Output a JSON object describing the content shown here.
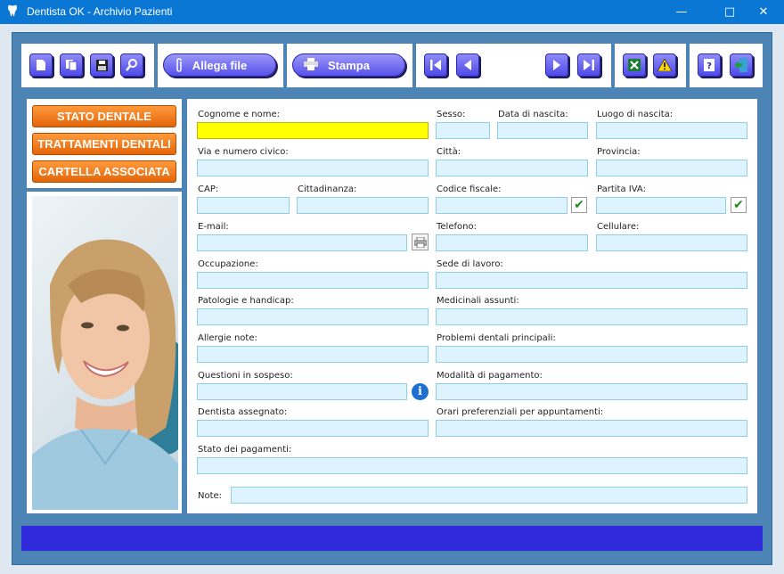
{
  "window": {
    "title": "Dentista OK - Archivio Pazienti",
    "app_icon": "tooth-icon",
    "controls": [
      "minimize-icon",
      "maximize-icon",
      "close-icon"
    ]
  },
  "toolbar": {
    "record_buttons": [
      "new-record-icon",
      "copy-record-icon",
      "save-icon",
      "search-icon"
    ],
    "attach_label": "Allega file",
    "print_label": "Stampa",
    "nav_buttons": [
      "first-record-icon",
      "previous-record-icon",
      "next-record-icon",
      "last-record-icon"
    ],
    "tool_buttons": [
      "excel-export-icon",
      "warning-icon"
    ],
    "help_buttons": [
      "help-icon",
      "exit-icon"
    ]
  },
  "side_nav": {
    "items": [
      "STATO DENTALE",
      "TRATTAMENTI DENTALI",
      "CARTELLA ASSOCIATA"
    ]
  },
  "form": {
    "cognome_nome": {
      "label": "Cognome e nome:",
      "value": ""
    },
    "sesso": {
      "label": "Sesso:",
      "value": ""
    },
    "data_nascita": {
      "label": "Data di nascita:",
      "value": ""
    },
    "luogo_nascita": {
      "label": "Luogo di nascita:",
      "value": ""
    },
    "via": {
      "label": "Via e numero civico:",
      "value": ""
    },
    "citta": {
      "label": "Città:",
      "value": ""
    },
    "provincia": {
      "label": "Provincia:",
      "value": ""
    },
    "cap": {
      "label": "CAP:",
      "value": ""
    },
    "cittadinanza": {
      "label": "Cittadinanza:",
      "value": ""
    },
    "codice_fiscale": {
      "label": "Codice fiscale:",
      "value": ""
    },
    "partita_iva": {
      "label": "Partita IVA:",
      "value": ""
    },
    "email": {
      "label": "E-mail:",
      "value": ""
    },
    "telefono": {
      "label": "Telefono:",
      "value": ""
    },
    "cellulare": {
      "label": "Cellulare:",
      "value": ""
    },
    "occupazione": {
      "label": "Occupazione:",
      "value": ""
    },
    "sede_lavoro": {
      "label": "Sede di lavoro:",
      "value": ""
    },
    "patologie": {
      "label": "Patologie e handicap:",
      "value": ""
    },
    "medicinali": {
      "label": "Medicinali assunti:",
      "value": ""
    },
    "allergie": {
      "label": "Allergie note:",
      "value": ""
    },
    "problemi": {
      "label": "Problemi dentali principali:",
      "value": ""
    },
    "questioni": {
      "label": "Questioni in sospeso:",
      "value": ""
    },
    "pagamento": {
      "label": "Modalità di pagamento:",
      "value": ""
    },
    "dentista": {
      "label": "Dentista assegnato:",
      "value": ""
    },
    "orari": {
      "label": "Orari preferenziali per appuntamenti:",
      "value": ""
    },
    "stato_pagamenti": {
      "label": "Stato dei pagamenti:",
      "value": ""
    },
    "note": {
      "label": "Note:",
      "value": ""
    }
  },
  "colors": {
    "titlebar": "#0a77d4",
    "frame": "#4b84b5",
    "nav_button": "#f07a1a",
    "field_bg": "#ddf3fd",
    "active_field": "#ffff00",
    "status_bar": "#2f2bdc"
  }
}
